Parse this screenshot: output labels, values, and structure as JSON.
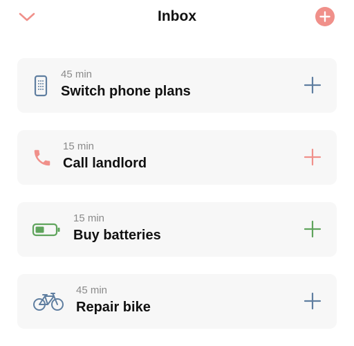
{
  "header": {
    "title": "Inbox",
    "collapse_icon": "chevron-down-icon",
    "add_icon": "plus-circle-icon",
    "accent_color": "#f0908a"
  },
  "tasks": [
    {
      "duration": "45 min",
      "title": "Switch phone plans",
      "icon": "phone-device-icon",
      "color": "#5f7ea0"
    },
    {
      "duration": "15 min",
      "title": "Call landlord",
      "icon": "phone-call-icon",
      "color": "#f0908a"
    },
    {
      "duration": "15 min",
      "title": "Buy batteries",
      "icon": "battery-icon",
      "color": "#5fa45c"
    },
    {
      "duration": "45 min",
      "title": "Repair bike",
      "icon": "bicycle-icon",
      "color": "#5f7ea0"
    }
  ]
}
